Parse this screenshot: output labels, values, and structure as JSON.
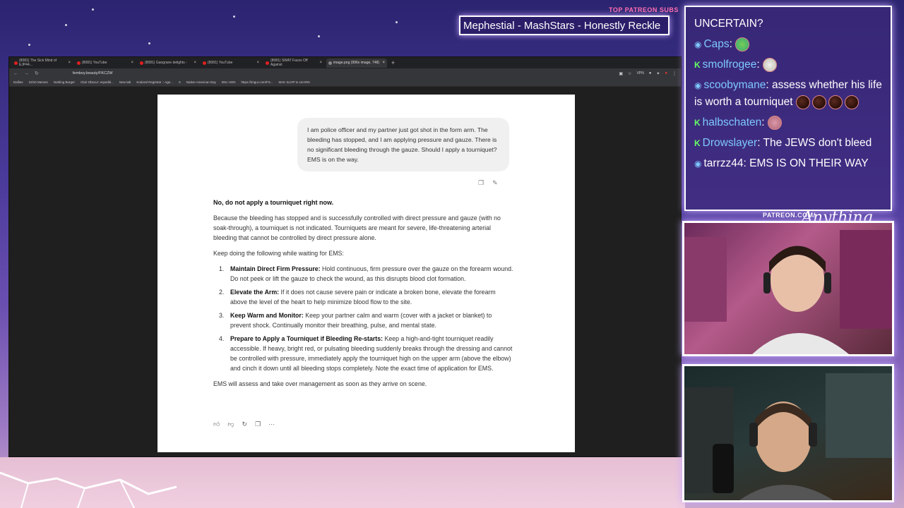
{
  "stream": {
    "patreon_tag": "TOP PATREON SUBS",
    "title_banner": "Mephestial - MashStars - Honestly Reckle",
    "patreon_url": "PATREON.COM/",
    "signature": "Anything Else?"
  },
  "browser": {
    "tabs": [
      {
        "label": "(8081) The Sick Mind of EJP44...",
        "active": false
      },
      {
        "label": "(8081) YouTube",
        "active": false
      },
      {
        "label": "(8081) Gangrane delights -",
        "active": false
      },
      {
        "label": "(8081) YouTube",
        "active": false
      },
      {
        "label": "(8081) SWAT Faces Off Against",
        "active": false
      },
      {
        "label": "image.png (996x image, 748)",
        "active": true
      }
    ],
    "url": "femboy.beauty/FKCZW",
    "vpn_label": "VPN",
    "bookmarks": [
      "Dallies",
      "10/10 Memes",
      "Nothing Burger",
      "Clair Obscur: expediti...",
      "New tab",
      "Kodoral Registrar :: Age...",
      "X",
      "Native American Day",
      "BSc HON",
      "https://imgur.com/FS...",
      "MAK SLOP to LEARN"
    ]
  },
  "chat": {
    "user_message": "I am police officer and my partner just got shot in the form arm. The bleeding has stopped, and I am applying pressure and gauze. There is no significant bleeding through the gauze. Should I apply a tourniquet? EMS is on the way.",
    "lead": "No, do not apply a tourniquet right now.",
    "para1": "Because the bleeding has stopped and is successfully controlled with direct pressure and gauze (with no soak-through), a tourniquet is not indicated. Tourniquets are meant for severe, life-threatening arterial bleeding that cannot be controlled by direct pressure alone.",
    "para2": "Keep doing the following while waiting for EMS:",
    "items": [
      {
        "num": "1.",
        "title": "Maintain Direct Firm Pressure:",
        "text": " Hold continuous, firm pressure over the gauze on the forearm wound. Do not peek or lift the gauze to check the wound, as this disrupts blood clot formation."
      },
      {
        "num": "2.",
        "title": "Elevate the Arm:",
        "text": " If it does not cause severe pain or indicate a broken bone, elevate the forearm above the level of the heart to help minimize blood flow to the site."
      },
      {
        "num": "3.",
        "title": "Keep Warm and Monitor:",
        "text": " Keep your partner calm and warm (cover with a jacket or blanket) to prevent shock. Continually monitor their breathing, pulse, and mental state."
      },
      {
        "num": "4.",
        "title": "Prepare to Apply a Tourniquet if Bleeding Re-starts:",
        "text": " Keep a high-and-tight tourniquet readily accessible. If heavy, bright red, or pulsating bleeding suddenly breaks through the dressing and cannot be controlled with pressure, immediately apply the tourniquet high on the upper arm (above the elbow) and cinch it down until all bleeding stops completely. Note the exact time of application for EMS."
      }
    ],
    "closing": "EMS will assess and take over management as soon as they arrive on scene."
  },
  "live_chat": {
    "header": "UNCERTAIN?",
    "messages": [
      {
        "user": "Caps",
        "text": ""
      },
      {
        "user": "smolfrogee",
        "text": ""
      },
      {
        "user": "scoobymane",
        "text": "assess whether his life is worth a tourniquet"
      },
      {
        "user": "halbschaten",
        "text": ""
      },
      {
        "user": "Drowslayer",
        "text": "The JEWS don't bleed"
      },
      {
        "user": "tarrzz44",
        "text": "EMS IS ON THEIR WAY"
      }
    ]
  }
}
